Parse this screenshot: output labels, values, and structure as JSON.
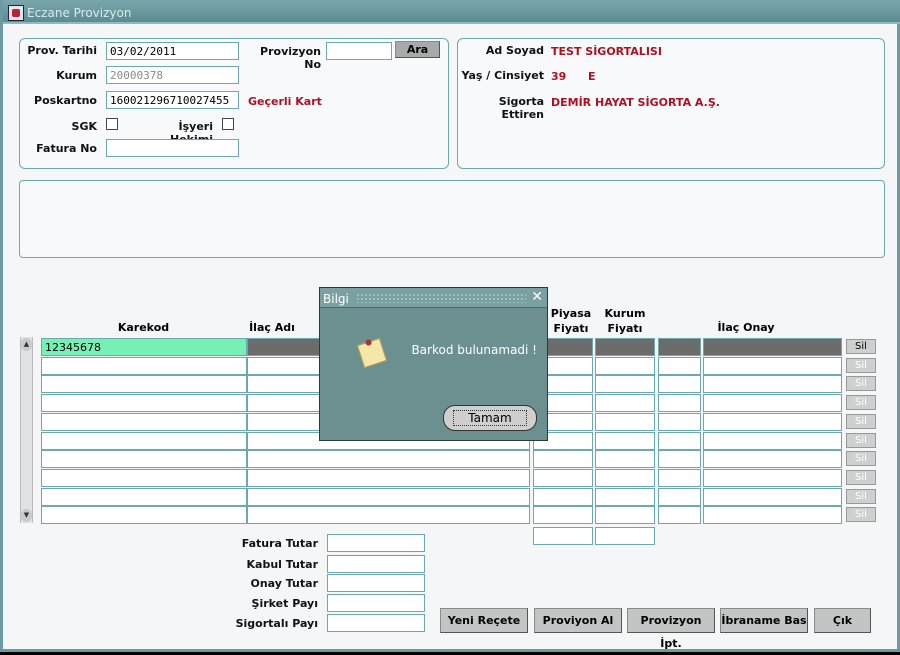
{
  "window": {
    "title": "Eczane Provizyon"
  },
  "form": {
    "prov_tarihi_label": "Prov. Tarihi",
    "prov_tarihi_value": "03/02/2011",
    "provizyon_no_label": "Provizyon No",
    "provizyon_no_value": "",
    "ara_label": "Ara",
    "kurum_label": "Kurum",
    "kurum_value": "20000378",
    "poskartno_label": "Poskartno",
    "poskartno_value": "160021296710027455",
    "kart_status": "Geçerli Kart",
    "sgk_label": "SGK",
    "isyeri_label": "İşyeri Hekimi",
    "fatura_no_label": "Fatura No",
    "fatura_no_value": ""
  },
  "patient": {
    "ad_soyad_label": "Ad Soyad",
    "ad_soyad_value": "TEST SİGORTALISI",
    "yas_label": "Yaş / Cinsiyet",
    "yas_value": "39",
    "cinsiyet_value": "E",
    "sigorta_label": "Sigorta Ettiren",
    "sigorta_value": "DEMİR HAYAT SİGORTA A.Ş."
  },
  "grid": {
    "headers": {
      "karekod": "Karekod",
      "ilac_adi": "İlaç Adı",
      "piyasa": "Piyasa Fiyatı",
      "kurum": "Kurum Fiyatı",
      "ilac_onay": "İlaç Onay"
    },
    "first_karekod": "12345678",
    "sil_label": "Sil"
  },
  "totals": {
    "fatura_tutar": "Fatura Tutar",
    "kabul_tutar": "Kabul Tutar",
    "onay_tutar": "Onay Tutar",
    "sirket_payi": "Şirket Payı",
    "sigortali_payi": "Sigortalı Payı"
  },
  "buttons": {
    "yeni_recete": "Yeni Reçete",
    "provizyon_al": "Proviyon Al",
    "provizyon_ipt": "Provizyon İpt.",
    "ibraname": "İbraname Bas",
    "cik": "Çık"
  },
  "dialog": {
    "title": "Bilgi",
    "message": "Barkod bulunamadi !",
    "ok_label": "Tamam"
  }
}
